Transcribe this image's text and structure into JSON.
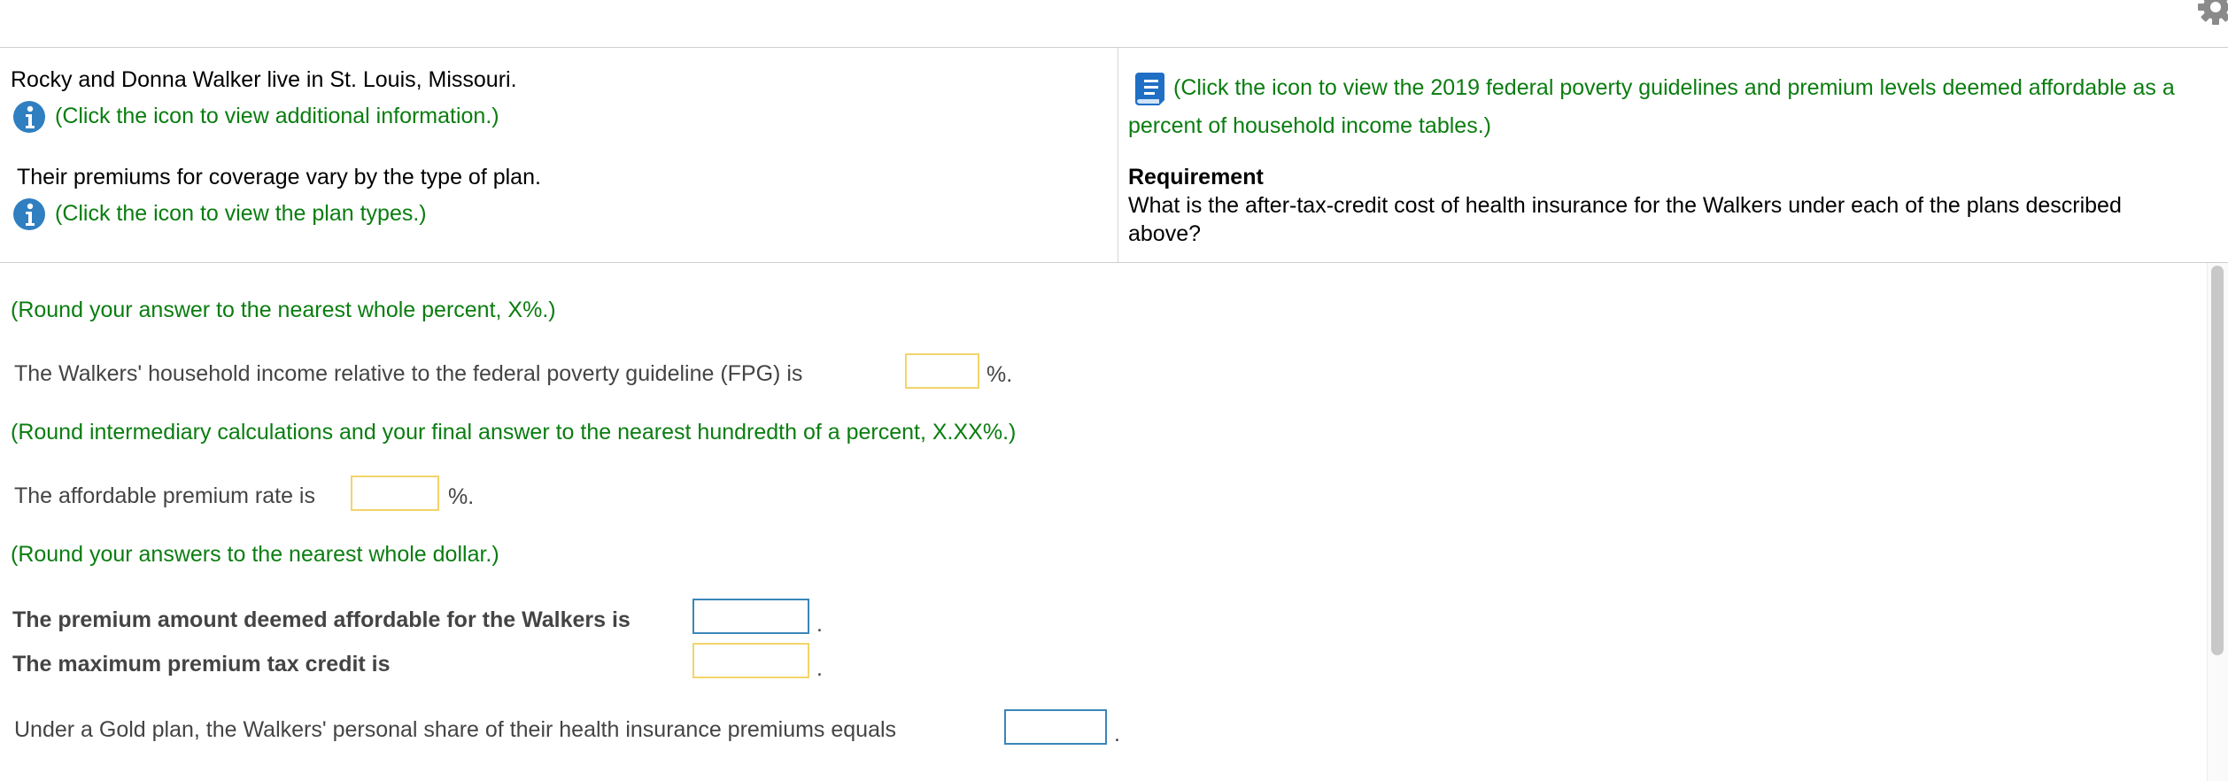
{
  "info": {
    "intro": "Rocky and Donna Walker live in St. Louis, Missouri.",
    "additional_info_link": "(Click the icon to view additional information.)",
    "premiums_text": "Their premiums for coverage vary by the type of plan.",
    "plan_types_link": "(Click the icon to view the plan types.)",
    "tables_link_line1": "(Click the icon to view the 2019 federal poverty guidelines and premium levels deemed affordable as a",
    "tables_link_line2": "percent of household income tables.)",
    "requirement_title": "Requirement",
    "requirement_line1": "What is the after-tax-credit cost of health insurance for the Walkers under each of the plans described",
    "requirement_line2": "above?"
  },
  "questions": {
    "round_whole_percent": "(Round your answer to the nearest whole percent, X%.)",
    "fpg_label": "The Walkers' household income relative to the federal poverty guideline (FPG) is",
    "fpg_value": "",
    "fpg_suffix": "%.",
    "round_hundredth": "(Round intermediary calculations and your final answer to the nearest hundredth of a percent, X.XX%.)",
    "rate_label": "The affordable premium rate is",
    "rate_value": "",
    "rate_suffix": "%.",
    "round_dollar": "(Round your answers to the nearest whole dollar.)",
    "affordable_label": "The premium amount deemed affordable for the Walkers is",
    "affordable_value": "",
    "affordable_suffix": ".",
    "max_credit_label": "The maximum premium tax credit is",
    "max_credit_value": "",
    "max_credit_suffix": ".",
    "gold_label": "Under a Gold plan, the Walkers' personal share of their health insurance premiums equals",
    "gold_value": "",
    "gold_suffix": "."
  },
  "colors": {
    "green_link": "#0a7d10",
    "info_blue": "#2f7fc1",
    "input_yellow": "#f3d46a",
    "input_blue": "#3b86b8"
  },
  "icons": {
    "settings": "gear-icon",
    "info": "info-icon",
    "tables": "book-icon"
  }
}
